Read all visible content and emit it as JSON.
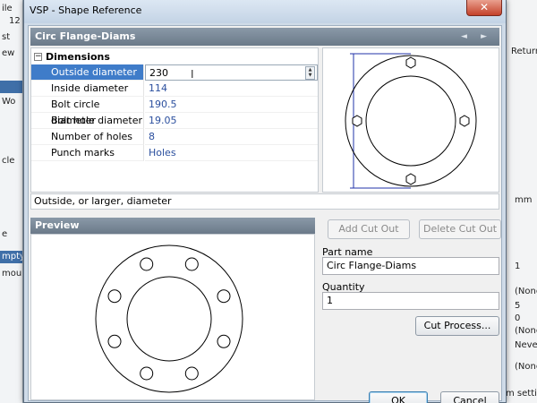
{
  "background": {
    "left_fragments": [
      "ile",
      "12",
      "st",
      "ew",
      "Wo",
      "cle",
      "e",
      "mpty",
      "mou"
    ],
    "right_fragments": [
      "Return",
      "mm",
      "1",
      "(None",
      "5",
      "0",
      "(None",
      "Never",
      "(None",
      "m settin"
    ]
  },
  "dialog": {
    "title": "VSP - Shape Reference",
    "close_glyph": "✕"
  },
  "shape": {
    "header": "Circ Flange-Diams",
    "nav": "◄ ►"
  },
  "properties": {
    "category": "Dimensions",
    "toggle": "−",
    "rows": [
      {
        "name": "Outside diameter",
        "value": "230"
      },
      {
        "name": "Inside diameter",
        "value": "114"
      },
      {
        "name": "Bolt circle diameter",
        "value": "190.5"
      },
      {
        "name": "Bolt hole diameter",
        "value": "19.05"
      },
      {
        "name": "Number of holes",
        "value": "8"
      },
      {
        "name": "Punch marks",
        "value": "Holes"
      }
    ],
    "description": "Outside, or larger, diameter"
  },
  "preview": {
    "header": "Preview",
    "holes": 8
  },
  "cutout": {
    "add_label": "Add Cut Out",
    "delete_label": "Delete Cut Out"
  },
  "part": {
    "name_label": "Part name",
    "name_value": "Circ Flange-Diams",
    "quantity_label": "Quantity",
    "quantity_value": "1"
  },
  "buttons": {
    "cut_process": "Cut Process...",
    "ok": "OK",
    "cancel": "Cancel"
  },
  "colors": {
    "selection": "#3f7cc9",
    "value_text": "#2b4f9e",
    "header_bg": "#7a8998",
    "drawing_line": "#000000",
    "dimension_line": "#2233aa"
  }
}
